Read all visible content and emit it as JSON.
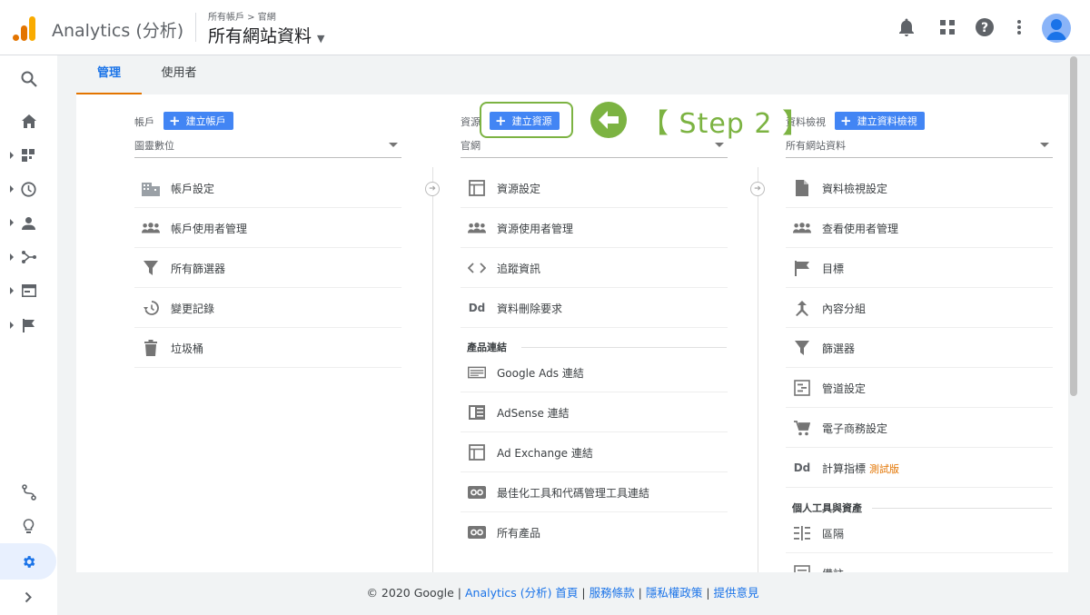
{
  "header": {
    "app_title": "Analytics (分析)",
    "breadcrumb": "所有帳戶 > 官網",
    "view_name": "所有網站資料"
  },
  "tabs": [
    {
      "label": "管理",
      "active": true
    },
    {
      "label": "使用者",
      "active": false
    }
  ],
  "account_column": {
    "label": "帳戶",
    "create_button": "建立帳戶",
    "selected": "圖靈數位",
    "items": [
      {
        "icon": "building-icon",
        "label": "帳戶設定"
      },
      {
        "icon": "people-icon",
        "label": "帳戶使用者管理"
      },
      {
        "icon": "filter-icon",
        "label": "所有篩選器"
      },
      {
        "icon": "history-icon",
        "label": "變更記錄"
      },
      {
        "icon": "trash-icon",
        "label": "垃圾桶"
      }
    ]
  },
  "property_column": {
    "label": "資源",
    "create_button": "建立資源",
    "selected": "官網",
    "items": [
      {
        "icon": "property-settings-icon",
        "label": "資源設定"
      },
      {
        "icon": "people-icon",
        "label": "資源使用者管理"
      },
      {
        "icon": "code-icon",
        "label": "追蹤資訊"
      },
      {
        "icon": "data-deletion-icon",
        "label": "資料刪除要求"
      }
    ],
    "section_title": "產品連結",
    "product_links": [
      {
        "icon": "google-ads-icon",
        "label": "Google Ads 連結"
      },
      {
        "icon": "adsense-icon",
        "label": "AdSense 連結"
      },
      {
        "icon": "ad-exchange-icon",
        "label": "Ad Exchange 連結"
      },
      {
        "icon": "link-icon",
        "label": "最佳化工具和代碼管理工具連結"
      },
      {
        "icon": "link-icon",
        "label": "所有產品"
      }
    ]
  },
  "view_column": {
    "label": "資料檢視",
    "create_button": "建立資料檢視",
    "selected": "所有網站資料",
    "items": [
      {
        "icon": "document-icon",
        "label": "資料檢視設定"
      },
      {
        "icon": "people-icon",
        "label": "查看使用者管理"
      },
      {
        "icon": "flag-icon",
        "label": "目標"
      },
      {
        "icon": "content-grouping-icon",
        "label": "內容分組"
      },
      {
        "icon": "filter-icon",
        "label": "篩選器"
      },
      {
        "icon": "channel-settings-icon",
        "label": "管道設定"
      },
      {
        "icon": "cart-icon",
        "label": "電子商務設定"
      },
      {
        "icon": "calculated-metrics-icon",
        "label": "計算指標",
        "badge": "測試版"
      }
    ],
    "section_title": "個人工具與資產",
    "personal_items": [
      {
        "icon": "segments-icon",
        "label": "區隔"
      },
      {
        "icon": "annotations-icon",
        "label": "備註"
      }
    ]
  },
  "annotation": {
    "step_label": "【 Step 2 】",
    "color": "#7cb342"
  },
  "footer": {
    "copyright": "© 2020 Google |",
    "links": [
      "Analytics (分析) 首頁",
      "服務條款",
      "隱私權政策",
      "提供意見"
    ],
    "separator": "|"
  },
  "colors": {
    "accent_blue": "#1a73e8",
    "button_blue": "#4285f4",
    "orange": "#e37400"
  }
}
